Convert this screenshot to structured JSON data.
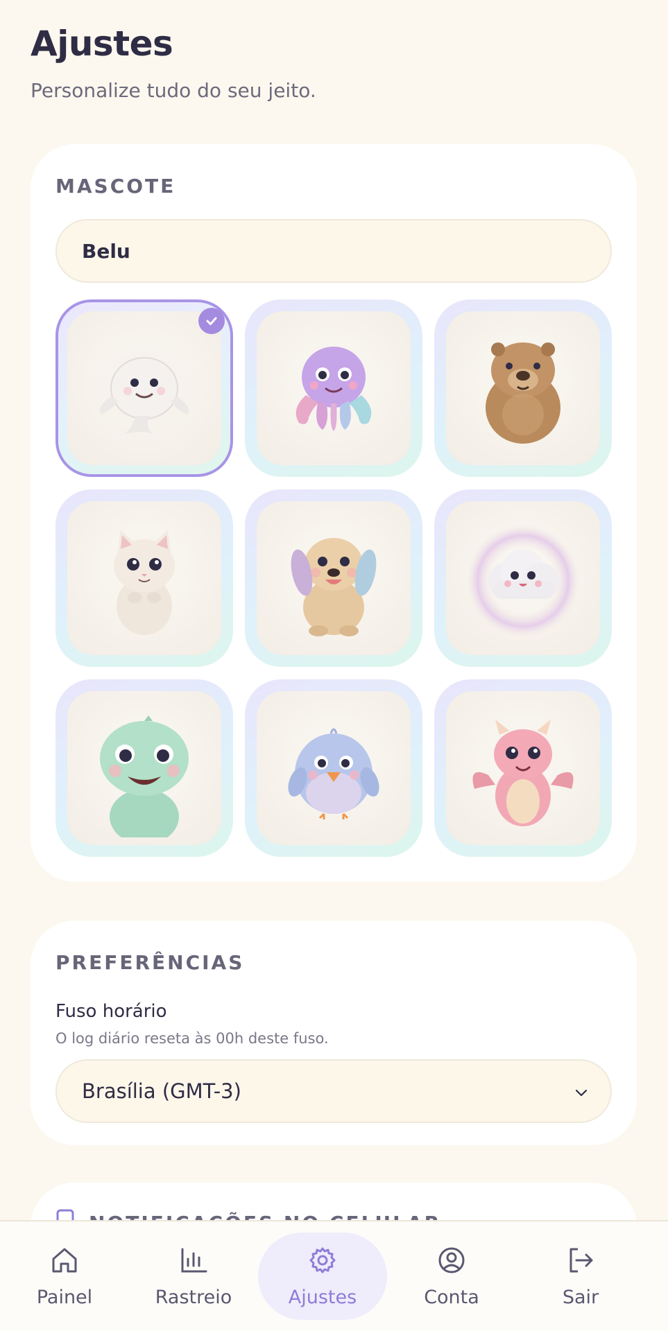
{
  "header": {
    "title": "Ajustes",
    "subtitle": "Personalize tudo do seu jeito."
  },
  "mascote": {
    "section_title": "MASCOTE",
    "name_value": "Belu",
    "selected_index": 0,
    "mascots": [
      {
        "icon": "beluga-mascot-icon"
      },
      {
        "icon": "octopus-mascot-icon"
      },
      {
        "icon": "capybara-mascot-icon"
      },
      {
        "icon": "cat-mascot-icon"
      },
      {
        "icon": "puppy-mascot-icon"
      },
      {
        "icon": "cloud-mascot-icon"
      },
      {
        "icon": "dinosaur-mascot-icon"
      },
      {
        "icon": "bird-mascot-icon"
      },
      {
        "icon": "dragon-mascot-icon"
      }
    ]
  },
  "preferencias": {
    "section_title": "PREFERÊNCIAS",
    "timezone_label": "Fuso horário",
    "timezone_help": "O log diário reseta às 00h deste fuso.",
    "timezone_value": "Brasília (GMT-3)"
  },
  "notificacoes": {
    "section_title": "NOTIFICAÇÕES NO CELULAR"
  },
  "nav": {
    "items": [
      {
        "label": "Painel",
        "icon": "home-icon"
      },
      {
        "label": "Rastreio",
        "icon": "bar-chart-icon"
      },
      {
        "label": "Ajustes",
        "icon": "gear-icon"
      },
      {
        "label": "Conta",
        "icon": "user-circle-icon"
      },
      {
        "label": "Sair",
        "icon": "logout-icon"
      }
    ],
    "active_index": 2
  },
  "colors": {
    "accent": "#a48be0",
    "background": "#fdf8ef",
    "card": "#ffffff",
    "input_bg": "#fdf7ea"
  }
}
